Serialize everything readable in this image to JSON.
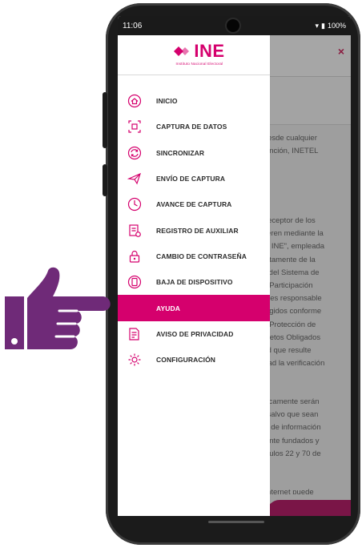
{
  "status_bar": {
    "time": "11:06",
    "battery": "100%"
  },
  "logo": {
    "brand": "INE",
    "subtitle": "Instituto Nacional Electoral"
  },
  "menu": {
    "items": [
      {
        "label": "INICIO",
        "icon": "home-icon"
      },
      {
        "label": "CAPTURA DE DATOS",
        "icon": "scan-icon"
      },
      {
        "label": "SINCRONIZAR",
        "icon": "sync-icon"
      },
      {
        "label": "ENVÍO DE CAPTURA",
        "icon": "send-icon"
      },
      {
        "label": "AVANCE DE CAPTURA",
        "icon": "progress-icon"
      },
      {
        "label": "REGISTRO DE AUXILIAR",
        "icon": "register-icon"
      },
      {
        "label": "CAMBIO DE CONTRASEÑA",
        "icon": "password-icon"
      },
      {
        "label": "BAJA DE DISPOSITIVO",
        "icon": "device-icon"
      },
      {
        "label": "AYUDA",
        "icon": "help-icon",
        "active": true
      },
      {
        "label": "AVISO DE PRIVACIDAD",
        "icon": "privacy-icon"
      },
      {
        "label": "CONFIGURACIÓN",
        "icon": "settings-icon"
      }
    ]
  },
  "background": {
    "close_symbol": "×",
    "text1": "r desde cualquier\natención, INETEL",
    "text2": "o receptor de los\nefieren mediante la\no – INE\", empleada\nrectamente de la\nes del Sistema de\nde Participación\nIE, es responsable\nutegidos conforme\nde Protección de\nSujetos Obligados\ndad que resulte\nilidad la verificación",
    "text3": "únicamente serán\na, salvo que sean\ntos de información\nmente fundados y\nrtículos 22 y 70 de",
    "text4": "a internet puede"
  },
  "colors": {
    "accent": "#d5006d",
    "hand": "#6f2a78",
    "bg_button": "#7a1547"
  }
}
